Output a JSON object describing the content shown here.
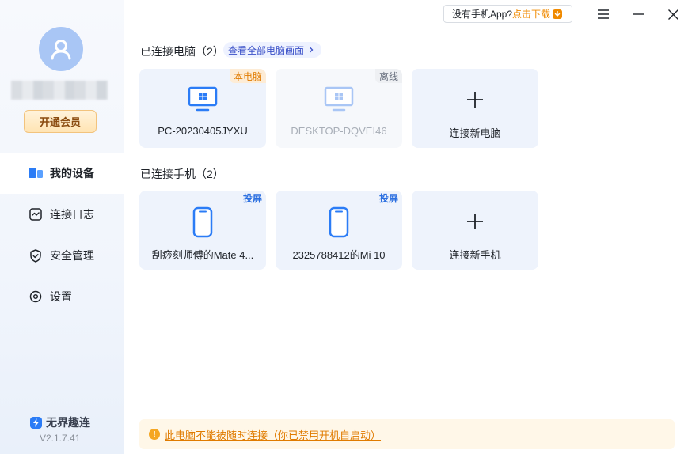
{
  "sidebar": {
    "vip_label": "开通会员",
    "items": [
      {
        "label": "我的设备",
        "icon": "devices-icon",
        "active": true
      },
      {
        "label": "连接日志",
        "icon": "log-icon",
        "active": false
      },
      {
        "label": "安全管理",
        "icon": "shield-icon",
        "active": false
      },
      {
        "label": "设置",
        "icon": "settings-icon",
        "active": false
      }
    ],
    "brand": "无界趣连",
    "version": "V2.1.7.41"
  },
  "topbar": {
    "no_app_text": "没有手机App?",
    "download_text": "点击下载"
  },
  "computers": {
    "title": "已连接电脑（2）",
    "view_all": "查看全部电脑画面",
    "devices": [
      {
        "name": "PC-20230405JYXU",
        "tag": "本电脑"
      },
      {
        "name": "DESKTOP-DQVEI46",
        "tag": "离线"
      }
    ],
    "add_label": "连接新电脑"
  },
  "phones": {
    "title": "已连接手机（2）",
    "devices": [
      {
        "name": "刮痧刻师傅的Mate 4...",
        "tag": "投屏"
      },
      {
        "name": "2325788412的Mi 10",
        "tag": "投屏"
      }
    ],
    "add_label": "连接新手机"
  },
  "warning": {
    "text": "此电脑不能被随时连接（你已禁用开机自启动）"
  },
  "colors": {
    "accent": "#2b7cf6",
    "warning": "#e07b00",
    "card_bg": "#eef3fc"
  }
}
